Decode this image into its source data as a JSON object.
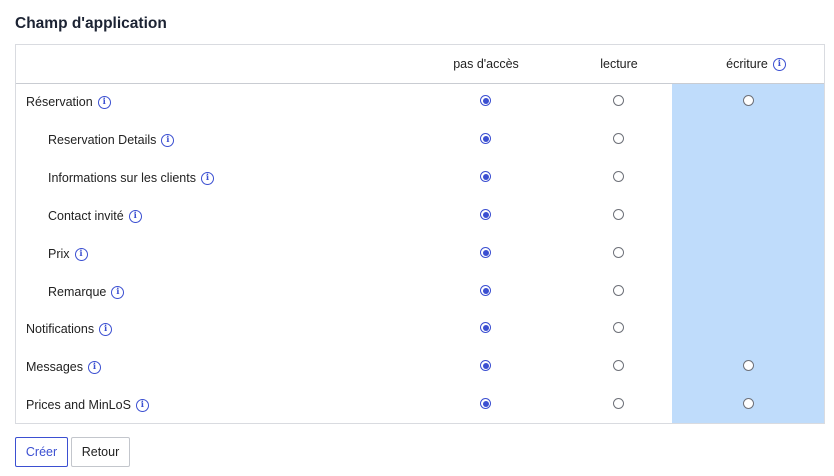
{
  "section": {
    "title": "Champ d'application"
  },
  "columns": {
    "none": "pas d'accès",
    "read": "lecture",
    "write": "écriture"
  },
  "info_glyph": "i",
  "colors": {
    "accent": "#3b4fd1",
    "write_band": "#bfdcfb"
  },
  "rows": [
    {
      "label": "Réservation",
      "selected": "none",
      "has_write": true
    },
    {
      "label": "Reservation Details",
      "selected": "none",
      "has_write": false
    },
    {
      "label": "Informations sur les clients",
      "selected": "none",
      "has_write": false
    },
    {
      "label": "Contact invité",
      "selected": "none",
      "has_write": false
    },
    {
      "label": "Prix",
      "selected": "none",
      "has_write": false
    },
    {
      "label": "Remarque",
      "selected": "none",
      "has_write": false
    },
    {
      "label": "Notifications",
      "selected": "none",
      "has_write": false
    },
    {
      "label": "Messages",
      "selected": "none",
      "has_write": true
    },
    {
      "label": "Prices and MinLoS",
      "selected": "none",
      "has_write": true
    }
  ],
  "buttons": {
    "create": "Créer",
    "back": "Retour"
  }
}
